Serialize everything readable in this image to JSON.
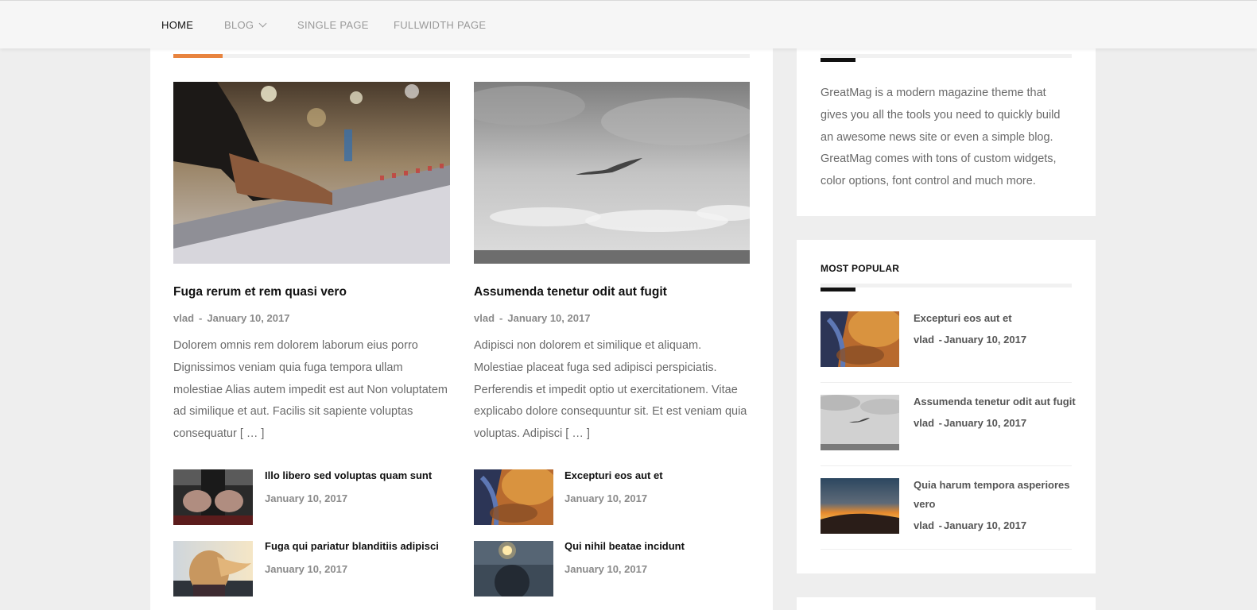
{
  "nav": {
    "items": [
      {
        "label": "HOME"
      },
      {
        "label": "BLOG"
      },
      {
        "label": "SINGLE PAGE"
      },
      {
        "label": "FULLWIDTH PAGE"
      }
    ]
  },
  "featured": [
    {
      "title": "Fuga rerum et rem quasi vero",
      "author": "vlad",
      "separator": "-",
      "date": "January 10, 2017",
      "excerpt": "Dolorem omnis rem dolorem laborum eius porro Dignissimos veniam quia fuga tempora ullam molestiae Alias autem impedit est aut Non voluptatem ad similique et aut. Facilis sit sapiente voluptas consequatur [ … ]"
    },
    {
      "title": "Assumenda tenetur odit aut fugit",
      "author": "vlad",
      "separator": "-",
      "date": "January 10, 2017",
      "excerpt": "Adipisci non dolorem et similique et aliquam. Molestiae placeat fuga sed adipisci perspiciatis. Perferendis et impedit optio ut exercitationem. Vitae explicabo dolore consequuntur sit. Et est veniam quia voluptas. Adipisci [ … ]"
    }
  ],
  "small_posts": [
    {
      "title": "Illo libero sed voluptas quam sunt",
      "date": "January 10, 2017"
    },
    {
      "title": "Excepturi eos aut et",
      "date": "January 10, 2017"
    },
    {
      "title": "Fuga qui pariatur blanditiis adipisci",
      "date": "January 10, 2017"
    },
    {
      "title": "Qui nihil beatae incidunt",
      "date": "January 10, 2017"
    }
  ],
  "sidebar": {
    "about": "GreatMag is a modern magazine theme that gives you all the tools you need to quickly build an awesome news site or even a simple blog. GreatMag comes with tons of custom widgets, color options, font control and much more.",
    "popular_title": "MOST POPULAR",
    "popular": [
      {
        "title": "Excepturi eos aut et",
        "author": "vlad",
        "separator": "-",
        "date": "January 10, 2017"
      },
      {
        "title": "Assumenda tenetur odit aut fugit",
        "author": "vlad",
        "separator": "-",
        "date": "January 10, 2017"
      },
      {
        "title": "Quia harum tempora asperiores vero",
        "author": "vlad",
        "separator": "-",
        "date": "January 10, 2017"
      }
    ]
  },
  "colors": {
    "accent": "#e8843f",
    "text": "#111111",
    "muted": "#8a8a8a",
    "body": "#6a6a6a",
    "background": "#eeeeee"
  }
}
